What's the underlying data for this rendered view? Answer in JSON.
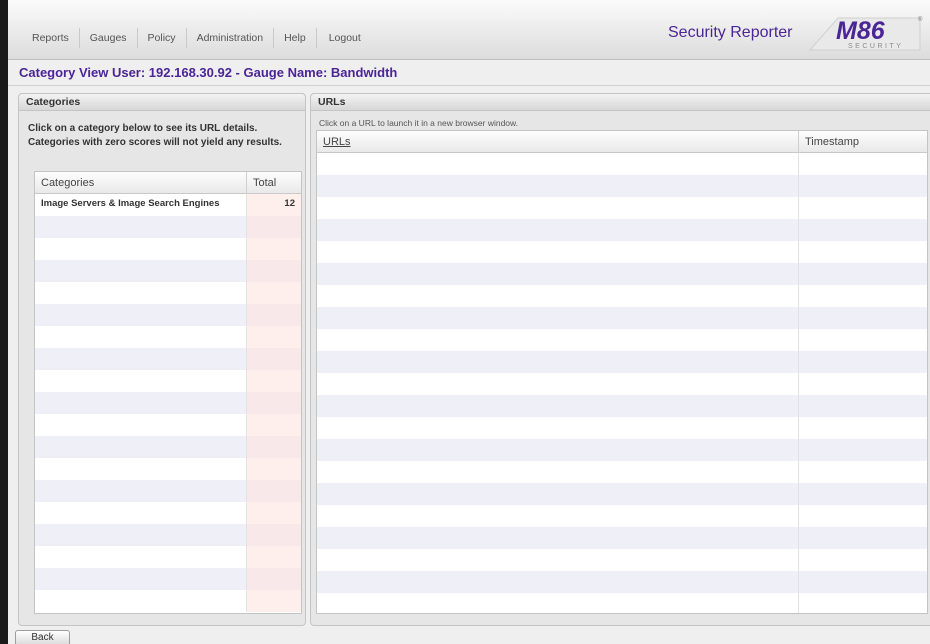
{
  "nav": {
    "items": [
      "Reports",
      "Gauges",
      "Policy",
      "Administration",
      "Help",
      "Logout"
    ]
  },
  "brand": {
    "product": "Security Reporter",
    "logo_text": "M86",
    "logo_sub": "SECURITY",
    "registered": "®",
    "accent_color": "#4b2596"
  },
  "page": {
    "title": "Category View User: 192.168.30.92 - Gauge Name: Bandwidth"
  },
  "categories_panel": {
    "title": "Categories",
    "instructions": "Click on a category below to see its URL details. Categories with zero scores will not yield any results.",
    "columns": [
      "Categories",
      "Total"
    ],
    "rows": [
      {
        "category": "Image Servers & Image Search Engines",
        "total": "12"
      }
    ]
  },
  "urls_panel": {
    "title": "URLs",
    "instructions": "Click on a URL to launch it in a new browser window.",
    "columns": [
      "URLs",
      "Timestamp"
    ],
    "rows": []
  },
  "footer": {
    "back_label": "Back"
  }
}
